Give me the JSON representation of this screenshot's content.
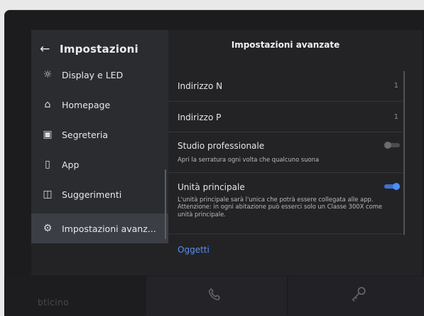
{
  "sidebar": {
    "back_icon": "arrow-left-icon",
    "title": "Impostazioni",
    "items": [
      {
        "label": "Display e LED",
        "icon": "sun-icon",
        "glyph": "☼"
      },
      {
        "label": "Homepage",
        "icon": "home-icon",
        "glyph": "⌂"
      },
      {
        "label": "Segreteria",
        "icon": "voicemail-icon",
        "glyph": "▣"
      },
      {
        "label": "App",
        "icon": "phone-icon",
        "glyph": "▯"
      },
      {
        "label": "Suggerimenti",
        "icon": "feedback-icon",
        "glyph": "◫"
      },
      {
        "label": "Impostazioni avanz...",
        "icon": "settings-icon",
        "glyph": "⚙",
        "active": true
      }
    ]
  },
  "panel": {
    "title": "Impostazioni avanzate",
    "rows": [
      {
        "label": "Indirizzo N",
        "value": "1"
      },
      {
        "label": "Indirizzo P",
        "value": "1"
      },
      {
        "label": "Studio professionale",
        "description": "Apri la serratura ogni volta che qualcuno suona",
        "toggle": "off"
      },
      {
        "label": "Unità principale",
        "description": "L'unità principale sarà l'unica che potrà essere collegata alle app. Attenzione: in ogni abitazione può esserci solo un Classe 300X come unità principale.",
        "toggle": "on"
      }
    ],
    "link": "Oggetti"
  },
  "bottom": {
    "brand": "bticino",
    "handset_icon": "phone-handset-icon",
    "key_icon": "key-icon"
  },
  "colors": {
    "accent": "#4e8ef5",
    "sidebar_bg": "#2a2c30",
    "panel_bg": "#232326"
  }
}
